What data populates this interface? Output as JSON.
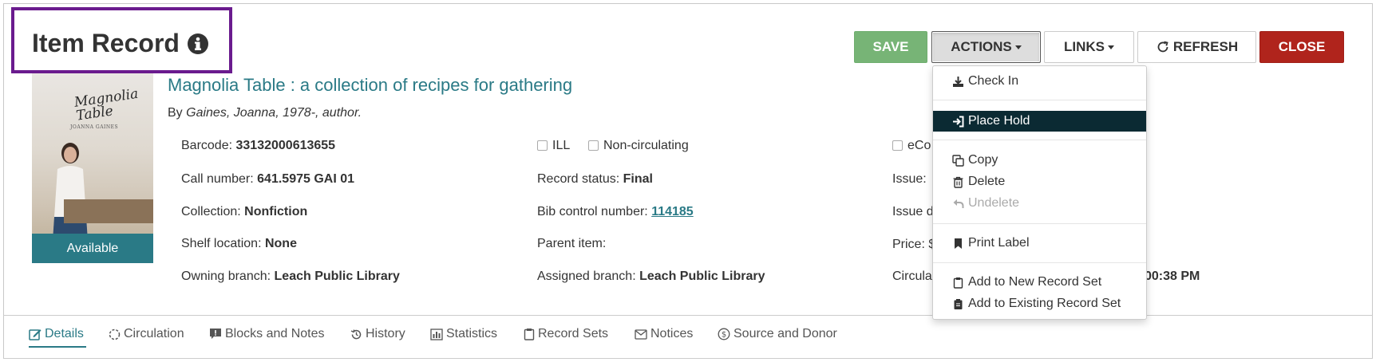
{
  "header": {
    "title": "Item Record"
  },
  "toolbar": {
    "save": "SAVE",
    "actions": "ACTIONS",
    "links": "LINKS",
    "refresh": "REFRESH",
    "close": "CLOSE"
  },
  "colors": {
    "accent": "#2a7a86",
    "save": "#77b476",
    "close": "#b0241c",
    "highlight": "#0b2a33",
    "title_box": "#6a1b8e"
  },
  "book": {
    "title": "Magnolia Table : a collection of recipes for gathering",
    "author_prefix": "By",
    "author": "Gaines, Joanna, 1978-, author.",
    "status": "Available",
    "cover_title": "Magnolia Table",
    "cover_subtitle": "JOANNA GAINES"
  },
  "fields": {
    "barcode_label": "Barcode:",
    "barcode": "33132000613655",
    "call_label": "Call number:",
    "call": "641.5975 GAI 01",
    "collection_label": "Collection:",
    "collection": "Nonfiction",
    "shelf_label": "Shelf location:",
    "shelf": "None",
    "owning_label": "Owning branch:",
    "owning": "Leach Public Library",
    "ill": "ILL",
    "noncirc": "Non-circulating",
    "record_status_label": "Record status:",
    "record_status": "Final",
    "bib_label": "Bib control number:",
    "bib": "114185",
    "parent_label": "Parent item:",
    "assigned_label": "Assigned branch:",
    "assigned": "Leach Public Library",
    "ecol_partial": "eCo",
    "issue_partial": "Issue:",
    "issue2_partial": "Issue d",
    "price_partial": "Price: $",
    "circ_partial": "Circula",
    "time_partial": "00:38 PM"
  },
  "menu": {
    "check_in": "Check In",
    "place_hold": "Place Hold",
    "copy": "Copy",
    "delete": "Delete",
    "undelete": "Undelete",
    "print_label": "Print Label",
    "add_new_set": "Add to New Record Set",
    "add_existing_set": "Add to Existing Record Set"
  },
  "tabs": {
    "details": "Details",
    "circulation": "Circulation",
    "blocks": "Blocks and Notes",
    "history": "History",
    "statistics": "Statistics",
    "record_sets": "Record Sets",
    "notices": "Notices",
    "source": "Source and Donor"
  }
}
